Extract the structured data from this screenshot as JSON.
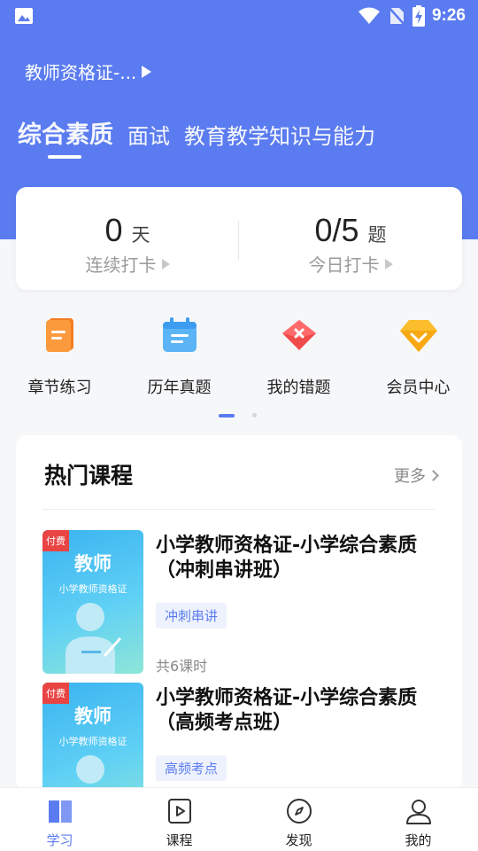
{
  "status_bar": {
    "time": "9:26"
  },
  "exam_selector": {
    "label": "教师资格证-..."
  },
  "tabs": [
    {
      "label": "综合素质",
      "active": true
    },
    {
      "label": "面试",
      "active": false
    },
    {
      "label": "教育教学知识与能力",
      "active": false
    }
  ],
  "checkin": {
    "streak": {
      "value": "0",
      "unit": "天",
      "label": "连续打卡"
    },
    "today": {
      "value": "0/5",
      "unit": "题",
      "label": "今日打卡"
    }
  },
  "quick_menu": [
    {
      "label": "章节练习",
      "icon": "chapter-practice-icon"
    },
    {
      "label": "历年真题",
      "icon": "calendar-icon"
    },
    {
      "label": "我的错题",
      "icon": "wrong-questions-icon"
    },
    {
      "label": "会员中心",
      "icon": "diamond-icon"
    }
  ],
  "hot_courses": {
    "title": "热门课程",
    "more": "更多",
    "items": [
      {
        "name": "小学教师资格证-小学综合素质（冲刺串讲班）",
        "tag": "冲刺串讲",
        "lessons": "共6课时",
        "badge": "付费",
        "thumb_title": "教师",
        "thumb_sub": "小学教师资格证"
      },
      {
        "name": "小学教师资格证-小学综合素质（高频考点班）",
        "tag": "高频考点",
        "badge": "付费",
        "thumb_title": "教师",
        "thumb_sub": "小学教师资格证"
      }
    ]
  },
  "bottom_nav": [
    {
      "label": "学习",
      "icon": "book-icon",
      "active": true
    },
    {
      "label": "课程",
      "icon": "play-icon",
      "active": false
    },
    {
      "label": "发现",
      "icon": "compass-icon",
      "active": false
    },
    {
      "label": "我的",
      "icon": "user-icon",
      "active": false
    }
  ],
  "colors": {
    "primary": "#5b7cf0",
    "paid_badge": "#e84444",
    "tag_bg": "#eef2fd"
  }
}
